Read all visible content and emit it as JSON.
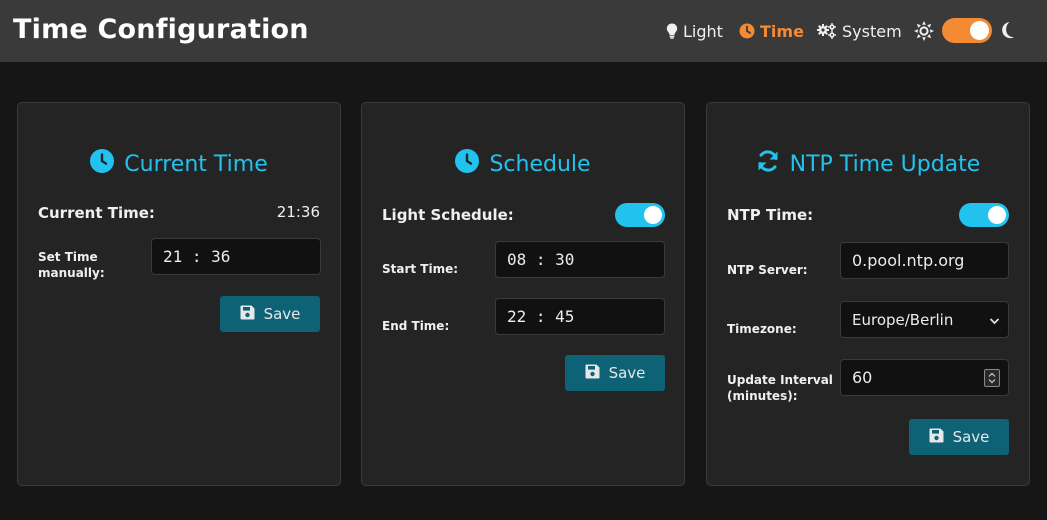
{
  "header": {
    "title": "Time Configuration",
    "nav": {
      "light": "Light",
      "time": "Time",
      "system": "System"
    },
    "theme_toggle_on": true
  },
  "colors": {
    "accent": "#21c3ee",
    "active_nav": "#f58a35",
    "button": "#0e6275"
  },
  "current_time_card": {
    "title": "Current Time",
    "current_label": "Current Time:",
    "current_value": "21:36",
    "set_label_line1": "Set Time",
    "set_label_line2": "manually:",
    "set_value": "21 : 36",
    "save_label": "Save"
  },
  "schedule_card": {
    "title": "Schedule",
    "light_schedule_label": "Light Schedule:",
    "light_schedule_on": true,
    "start_label": "Start Time:",
    "start_value": "08 : 30",
    "end_label": "End Time:",
    "end_value": "22 : 45",
    "save_label": "Save"
  },
  "ntp_card": {
    "title": "NTP Time Update",
    "ntp_label": "NTP Time:",
    "ntp_on": true,
    "server_label": "NTP Server:",
    "server_value": "0.pool.ntp.org",
    "timezone_label": "Timezone:",
    "timezone_value": "Europe/Berlin",
    "interval_label_line1": "Update Interval",
    "interval_label_line2": "(minutes):",
    "interval_value": "60",
    "save_label": "Save"
  },
  "icons": [
    "lightbulb-icon",
    "clock-icon",
    "gears-icon",
    "sun-icon",
    "moon-icon",
    "sync-icon",
    "floppy-disk-icon",
    "chevron-down-icon"
  ]
}
